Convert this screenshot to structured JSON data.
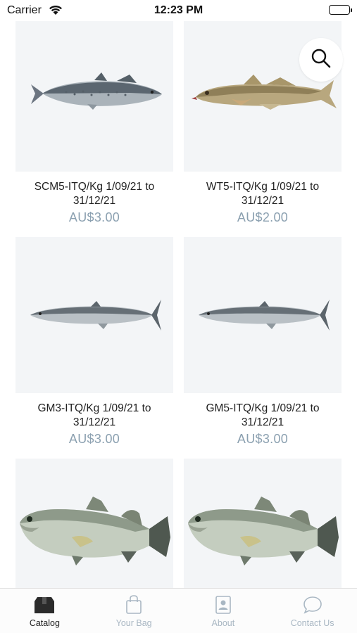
{
  "status_bar": {
    "carrier": "Carrier",
    "time": "12:23 PM"
  },
  "colors": {
    "price": "#8ba0b0",
    "tab_inactive": "#a9b7c3",
    "tab_active": "#222222",
    "card_background": "#f3f5f7"
  },
  "search": {
    "icon": "search-icon"
  },
  "products": [
    {
      "title": "SCM5-ITQ/Kg 1/09/21 to 31/12/21",
      "price": "AU$3.00",
      "image": "spanish-mackerel"
    },
    {
      "title": "WT5-ITQ/Kg 1/09/21 to 31/12/21",
      "price": "AU$2.00",
      "image": "whiting"
    },
    {
      "title": "GM3-ITQ/Kg 1/09/21 to 31/12/21",
      "price": "AU$3.00",
      "image": "grey-mackerel"
    },
    {
      "title": "GM5-ITQ/Kg 1/09/21 to 31/12/21",
      "price": "AU$3.00",
      "image": "grey-mackerel"
    },
    {
      "title": "",
      "price": "",
      "image": "barramundi"
    },
    {
      "title": "",
      "price": "",
      "image": "barramundi"
    }
  ],
  "tabs": [
    {
      "label": "Catalog",
      "icon": "catalog-box-icon",
      "active": true
    },
    {
      "label": "Your Bag",
      "icon": "shopping-bag-icon",
      "active": false
    },
    {
      "label": "About",
      "icon": "contact-card-icon",
      "active": false
    },
    {
      "label": "Contact Us",
      "icon": "chat-bubble-icon",
      "active": false
    }
  ]
}
